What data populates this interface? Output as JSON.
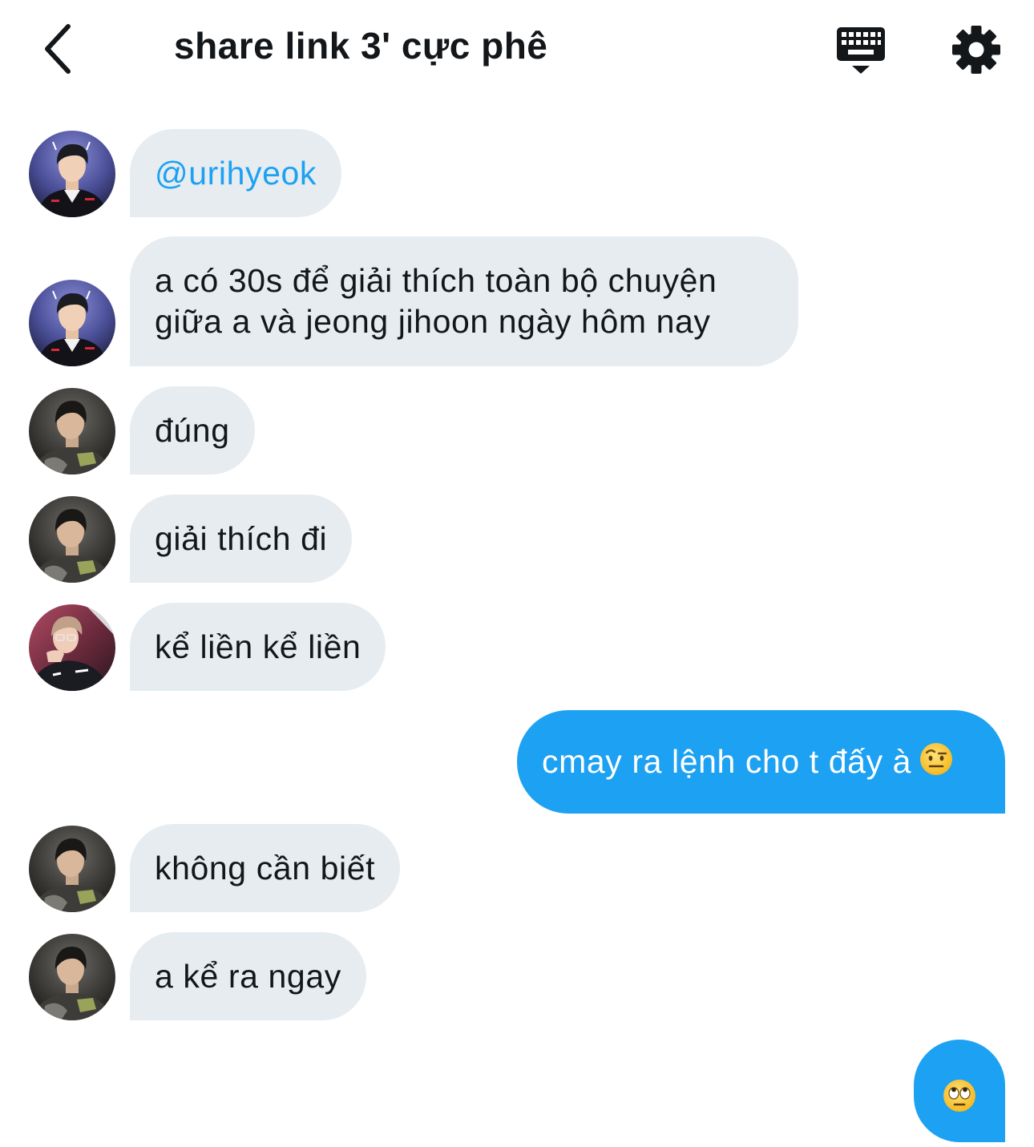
{
  "header": {
    "title": "share link 3' cực phê",
    "back_icon": "chevron-left-icon",
    "keyboard_icon": "keyboard-icon",
    "settings_icon": "gear-icon"
  },
  "colors": {
    "incoming_bubble": "#e6ecf0",
    "outgoing_bubble": "#1da1f2",
    "mention": "#1da1f2",
    "text": "#14171a"
  },
  "messages": [
    {
      "direction": "in",
      "avatar": "user-blue-jersey",
      "text": "@urihyeok"
    },
    {
      "direction": "in",
      "avatar": "user-blue-jersey",
      "line1": "a có 30s để giải thích toàn bộ chuyện",
      "line2": "giữa a và jeong jihoon ngày hôm nay"
    },
    {
      "direction": "in",
      "avatar": "user-dark-jacket",
      "text": "đúng"
    },
    {
      "direction": "in",
      "avatar": "user-dark-jacket",
      "text": "giải thích đi"
    },
    {
      "direction": "in",
      "avatar": "user-red-background",
      "text": "kể liền kể liền"
    },
    {
      "direction": "out",
      "text": "cmay ra lệnh cho t đấy à",
      "emoji": "raised-eyebrow-emoji"
    },
    {
      "direction": "in",
      "avatar": "user-dark-jacket",
      "text": "không cần biết"
    },
    {
      "direction": "in",
      "avatar": "user-dark-jacket",
      "text": "a kể ra ngay"
    },
    {
      "direction": "out",
      "emoji": "rolling-eyes-emoji"
    }
  ]
}
